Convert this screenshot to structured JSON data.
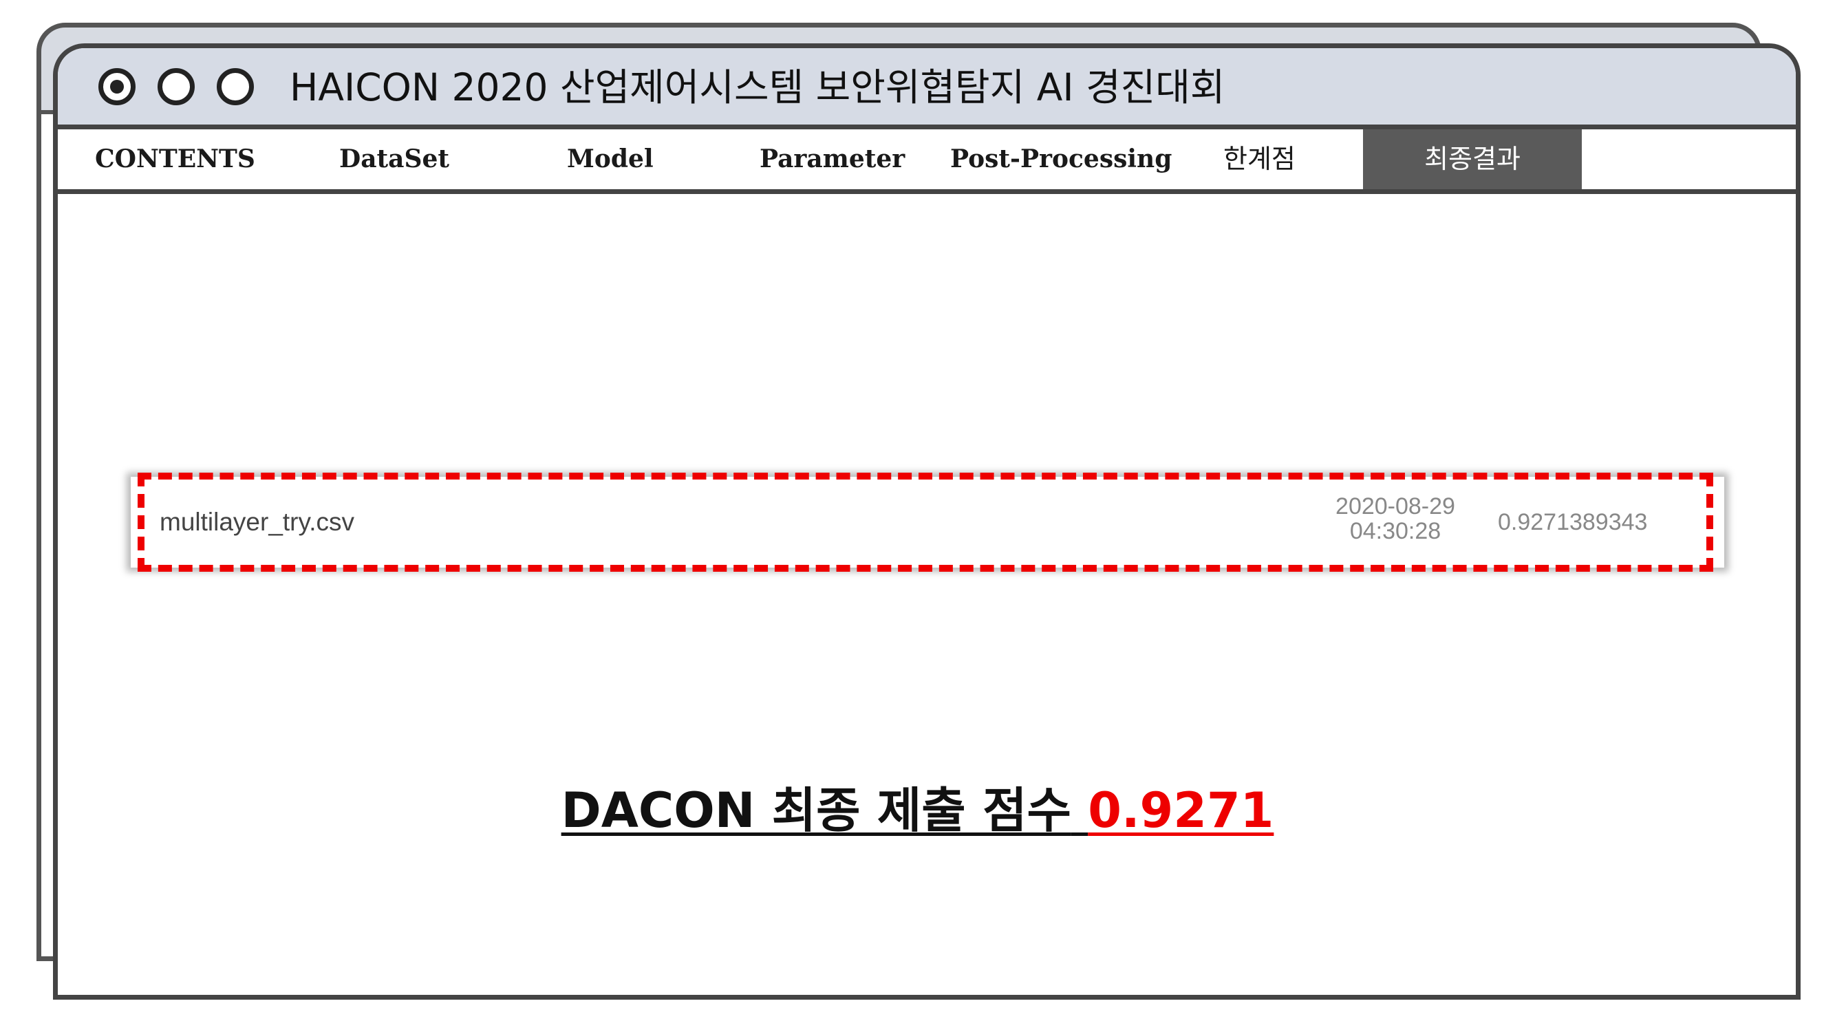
{
  "window": {
    "title": "HAICON 2020 산업제어시스템 보안위협탐지 AI 경진대회"
  },
  "nav": {
    "items": [
      {
        "label": "CONTENTS"
      },
      {
        "label": "DataSet"
      },
      {
        "label": "Model"
      },
      {
        "label": "Parameter"
      },
      {
        "label": "Post-Processing"
      },
      {
        "label": "한계점"
      },
      {
        "label": "최종결과",
        "active": true
      }
    ]
  },
  "submission": {
    "filename": "multilayer_try.csv",
    "date": "2020-08-29",
    "time": "04:30:28",
    "score": "0.9271389343"
  },
  "final": {
    "label": "DACON 최종 제출 점수",
    "value": "0.9271"
  },
  "colors": {
    "highlight": "#ee0000",
    "titlebar": "#d6dbe5",
    "active_tab": "#5a5a5a"
  }
}
